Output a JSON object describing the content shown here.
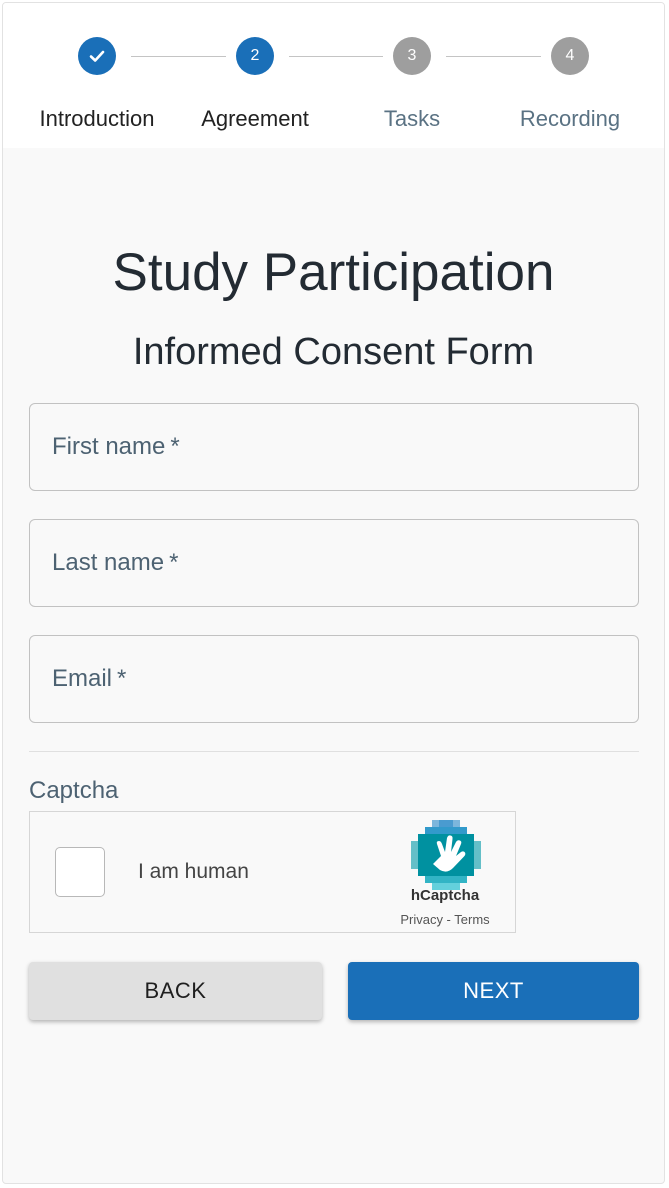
{
  "stepper": {
    "steps": [
      {
        "number": "1",
        "label": "Introduction",
        "state": "completed"
      },
      {
        "number": "2",
        "label": "Agreement",
        "state": "active"
      },
      {
        "number": "3",
        "label": "Tasks",
        "state": "pending"
      },
      {
        "number": "4",
        "label": "Recording",
        "state": "pending"
      }
    ],
    "check_icon": "check-icon"
  },
  "page": {
    "title": "Study Participation",
    "subtitle": "Informed Consent Form"
  },
  "form": {
    "first_name": {
      "label": "First name",
      "required_mark": "*",
      "value": ""
    },
    "last_name": {
      "label": "Last name",
      "required_mark": "*",
      "value": ""
    },
    "email": {
      "label": "Email",
      "required_mark": "*",
      "value": ""
    }
  },
  "captcha": {
    "section_label": "Captcha",
    "checkbox_label": "I am human",
    "checked": false,
    "brand": "hCaptcha",
    "links": "Privacy - Terms",
    "logo_icon": "hcaptcha-logo-icon"
  },
  "actions": {
    "back_label": "BACK",
    "next_label": "NEXT"
  },
  "colors": {
    "primary": "#1a6fb8",
    "pending": "#9e9e9e",
    "background": "#f9f9f9"
  }
}
